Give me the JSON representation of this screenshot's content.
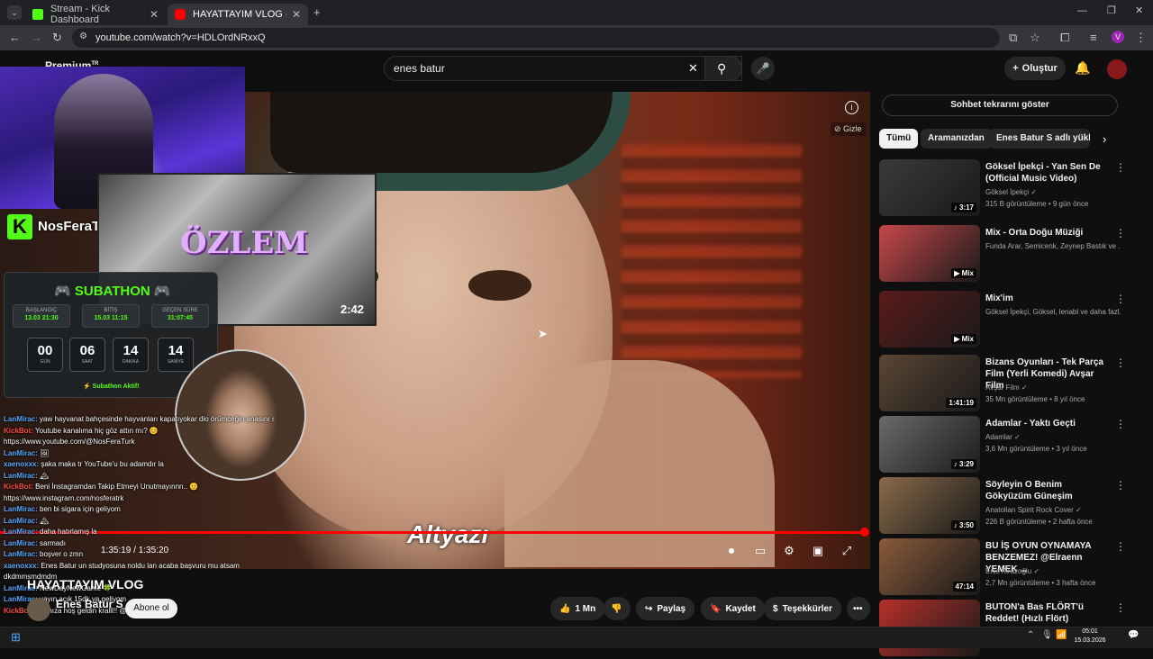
{
  "browser": {
    "tabs": [
      {
        "title": "Stream - Kick Dashboard",
        "active": false
      },
      {
        "title": "HAYATTAYIM VLOG - YouTu",
        "active": true
      }
    ],
    "url": "youtube.com/watch?v=HDLOrdNRxxQ"
  },
  "youtube": {
    "logo": "Premium",
    "logo_region": "TR",
    "search_value": "enes batur",
    "create_label": "Oluştur"
  },
  "player": {
    "subtitle": "Altyazı",
    "time": "1:35:19 / 1:35:20",
    "hide_label": "Gizle",
    "progress_fraction": 0.999
  },
  "overlay": {
    "channel": "NosFeraTurk",
    "thumb_title": "ÖZLEM",
    "thumb_duration": "2:42",
    "subathon": {
      "title": "SUBATHON",
      "start_label": "BAŞLANGIÇ",
      "start_value": "13.03 21:30",
      "end_label": "BİTİŞ",
      "end_value": "15.03 11:15",
      "elapsed_label": "GEÇEN SÜRE",
      "elapsed_value": "31:07:45",
      "countdown": [
        {
          "n": "00",
          "u": "GÜN"
        },
        {
          "n": "06",
          "u": "SAAT"
        },
        {
          "n": "14",
          "u": "DAKİKA"
        },
        {
          "n": "14",
          "u": "SANİYE"
        }
      ],
      "status": "⚡ Subathon Aktif!"
    }
  },
  "chat": [
    {
      "user": "LanMirac:",
      "text": " yaw hayvanat bahçesinde hayvanları kapatıyokar dio örümceğin anasını sikti",
      "bot": false
    },
    {
      "user": "KickBot:",
      "text": " Youtube kanalıma hiç göz attın mı? 😊",
      "bot": true
    },
    {
      "user": "",
      "text": "https://www.youtube.com/@NosFeraTurk",
      "bot": false
    },
    {
      "user": "LanMirac:",
      "text": " 🖼",
      "bot": false
    },
    {
      "user": "xaenoxxx:",
      "text": " şaka maka tr YouTube'u bu adamdır la",
      "bot": false
    },
    {
      "user": "LanMirac:",
      "text": " 🏔",
      "bot": false
    },
    {
      "user": "KickBot:",
      "text": " Beni İnstagramdan Takip Etmeyi Unutmayınnn.. 😊",
      "bot": true
    },
    {
      "user": "",
      "text": "https://www.instagram.com/nosferatrk",
      "bot": false
    },
    {
      "user": "LanMirac:",
      "text": " ben bi sigara için geliyom",
      "bot": false
    },
    {
      "user": "LanMirac:",
      "text": " 🏔",
      "bot": false
    },
    {
      "user": "LanMirac:",
      "text": " daha hatırlamış la",
      "bot": false
    },
    {
      "user": "LanMirac:",
      "text": " sarmadı",
      "bot": false
    },
    {
      "user": "LanMirac:",
      "text": " boşver o zmn",
      "bot": false
    },
    {
      "user": "xaenoxxx:",
      "text": " Enes Batur un studyosuna noldu lan acaba başvuru mu atsam",
      "bot": false
    },
    {
      "user": "",
      "text": "dkdmmsmdmdm",
      "bot": false
    },
    {
      "user": "LanMirac:",
      "text": " NewDayNewGame 🍀",
      "bot": false
    },
    {
      "user": "LanMirac:",
      "text": " yayın açık 15dk ya geliyom",
      "bot": false
    },
    {
      "user": "KickBot:",
      "text": " Aramıza hoş geldin kralll!! @yalımylyen",
      "bot": true
    }
  ],
  "below": {
    "title": "HAYATTAYIM VLOG",
    "channel": "Enes Batur S",
    "subscribe": "Abone ol",
    "likes": "1 Mn",
    "share": "Paylaş",
    "save": "Kaydet",
    "thanks": "Teşekkürler"
  },
  "sidebar": {
    "chat_replay": "Sohbet tekrarını göster",
    "chips": [
      "Tümü",
      "Aramanızdan",
      "Enes Batur S adlı yükley"
    ],
    "recs": [
      {
        "title": "Göksel İpekçi - Yan Sen De (Official Music Video)",
        "channel": "Göksel İpekçi ✓",
        "meta": "315 B görüntüleme • 9 gün önce",
        "dur": "♪ 3:17",
        "color": "#3a3a3a"
      },
      {
        "title": "Mix - Orta Doğu Müziği",
        "channel": "Funda Arar, Semicenk, Zeynep Bastık ve ...",
        "meta": "",
        "dur": "▶ Mix",
        "color": "#c7474a"
      },
      {
        "title": "Mix'im",
        "channel": "Göksel İpekçi, Göksel, lenabl ve daha fazl...",
        "meta": "",
        "dur": "▶ Mix",
        "color": "#5a1a1a"
      },
      {
        "title": "Bizans Oyunları - Tek Parça Film (Yerli Komedi) Avşar Film",
        "channel": "Avşar Film ✓",
        "meta": "35 Mn görüntüleme • 8 yıl önce",
        "dur": "1:41:19",
        "color": "#5a4634"
      },
      {
        "title": "Adamlar - Yaktı Geçti",
        "channel": "Adamlar ✓",
        "meta": "3,6 Mn görüntüleme • 3 yıl önce",
        "dur": "♪ 3:29",
        "color": "#6a6a6a"
      },
      {
        "title": "Söyleyin O Benim Gökyüzüm Güneşim",
        "channel": "Anatolian Spirit Rock Cover ✓",
        "meta": "226 B görüntüleme • 2 hafta önce",
        "dur": "♪ 3:50",
        "color": "#8a6a4a"
      },
      {
        "title": "BU İŞ OYUN OYNAMAYA BENZEMEZ! @Elraenn YEMEK ...",
        "channel": "Enis Kirazoğlu ✓",
        "meta": "2,7 Mn görüntüleme • 3 hafta önce",
        "dur": "47:14",
        "color": "#8a5a3a"
      },
      {
        "title": "BUTON'a Bas FLÖRT'ü Reddet! (Hızlı Flört)",
        "channel": "",
        "meta": "",
        "dur": "",
        "color": "#b8302a"
      }
    ]
  },
  "taskbar": {
    "time": "05:01",
    "date": "15.03.2026"
  }
}
